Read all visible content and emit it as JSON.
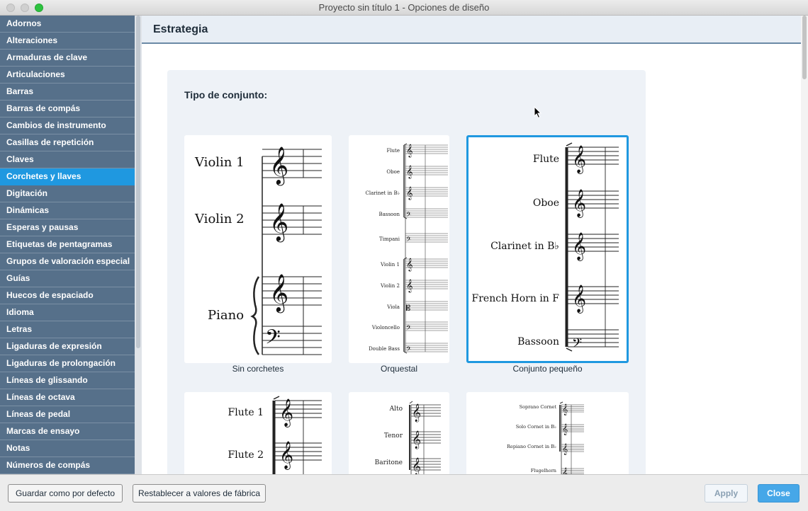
{
  "window": {
    "title": "Proyecto sin título 1 - Opciones de diseño"
  },
  "sidebar": {
    "items": [
      {
        "label": "Adornos",
        "active": false
      },
      {
        "label": "Alteraciones",
        "active": false
      },
      {
        "label": "Armaduras de clave",
        "active": false
      },
      {
        "label": "Articulaciones",
        "active": false
      },
      {
        "label": "Barras",
        "active": false
      },
      {
        "label": "Barras de compás",
        "active": false
      },
      {
        "label": "Cambios de instrumento",
        "active": false
      },
      {
        "label": "Casillas de repetición",
        "active": false
      },
      {
        "label": "Claves",
        "active": false
      },
      {
        "label": "Corchetes y llaves",
        "active": true
      },
      {
        "label": "Digitación",
        "active": false
      },
      {
        "label": "Dinámicas",
        "active": false
      },
      {
        "label": "Esperas y pausas",
        "active": false
      },
      {
        "label": "Etiquetas de pentagramas",
        "active": false
      },
      {
        "label": "Grupos de valoración especial",
        "active": false
      },
      {
        "label": "Guías",
        "active": false
      },
      {
        "label": "Huecos de espaciado",
        "active": false
      },
      {
        "label": "Idioma",
        "active": false
      },
      {
        "label": "Letras",
        "active": false
      },
      {
        "label": "Ligaduras de expresión",
        "active": false
      },
      {
        "label": "Ligaduras de prolongación",
        "active": false
      },
      {
        "label": "Líneas de glissando",
        "active": false
      },
      {
        "label": "Líneas de octava",
        "active": false
      },
      {
        "label": "Líneas de pedal",
        "active": false
      },
      {
        "label": "Marcas de ensayo",
        "active": false
      },
      {
        "label": "Notas",
        "active": false
      },
      {
        "label": "Números de compás",
        "active": false
      }
    ]
  },
  "main": {
    "title": "Estrategia",
    "ensemble_label": "Tipo de conjunto:",
    "options": [
      {
        "caption": "Sin corchetes",
        "selected": false,
        "staves": [
          "Violin 1",
          "Violin 2",
          "Piano"
        ]
      },
      {
        "caption": "Orquestal",
        "selected": false,
        "staves": [
          "Flute",
          "Oboe",
          "Clarinet in B♭",
          "Bassoon",
          "Timpani",
          "Violin 1",
          "Violin 2",
          "Viola",
          "Violoncello",
          "Double Bass"
        ]
      },
      {
        "caption": "Conjunto pequeño",
        "selected": true,
        "staves": [
          "Flute",
          "Oboe",
          "Clarinet in B♭",
          "French Horn in F",
          "Bassoon"
        ]
      },
      {
        "caption": "",
        "selected": false,
        "staves": [
          "Flute 1",
          "Flute 2"
        ]
      },
      {
        "caption": "",
        "selected": false,
        "staves": [
          "Alto",
          "Tenor",
          "Baritone"
        ]
      },
      {
        "caption": "",
        "selected": false,
        "staves": [
          "Soprano Cornet",
          "Solo Cornet in B♭",
          "Repiano Cornet in B♭",
          "Flugelhorn"
        ]
      }
    ]
  },
  "footer": {
    "save_default": "Guardar como por defecto",
    "reset": "Restablecer a valores de fábrica",
    "apply": "Apply",
    "close": "Close"
  },
  "colors": {
    "sidebar_bg": "#56708a",
    "accent": "#1f98e0",
    "close_button": "#46a7e8"
  },
  "icons": {
    "cursor": "arrow-cursor-icon"
  }
}
